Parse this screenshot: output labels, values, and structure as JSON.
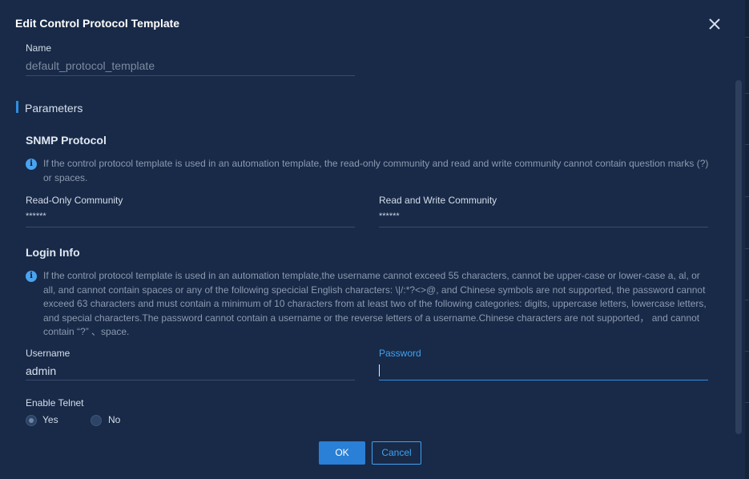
{
  "dialog": {
    "title": "Edit Control Protocol Template"
  },
  "name_field": {
    "label": "Name",
    "value": "default_protocol_template"
  },
  "parameters": {
    "title": "Parameters"
  },
  "snmp": {
    "title": "SNMP Protocol",
    "info": "If the control protocol template is used in an automation template, the read-only community and read and write community cannot contain question marks (?) or spaces.",
    "read_only_label": "Read-Only Community",
    "read_only_value": "******",
    "read_write_label": "Read and Write Community",
    "read_write_value": "******"
  },
  "login": {
    "title": "Login Info",
    "info": "If the control protocol template is used in an automation template,the username cannot exceed 55 characters, cannot be upper-case or lower-case a, al, or all, and cannot contain spaces or any of the following specicial English characters: \\|/:*?<>@, and Chinese symbols are not supported, the password cannot exceed 63 characters and must contain a minimum of 10 characters from at least two of the following categories: digits, uppercase letters, lowercase letters, and special characters.The password cannot contain a username or the reverse letters of a username.Chinese characters are not supported， and cannot contain “?” 、space.",
    "username_label": "Username",
    "username_value": "admin",
    "password_label": "Password",
    "password_value": ""
  },
  "telnet": {
    "label": "Enable Telnet",
    "options": [
      "Yes",
      "No"
    ],
    "selected": "Yes"
  },
  "buttons": {
    "ok": "OK",
    "cancel": "Cancel"
  },
  "colors": {
    "accent": "#2f8ee0",
    "background": "#182a48"
  },
  "icons": {
    "close": "close-icon",
    "info": "info-icon"
  }
}
